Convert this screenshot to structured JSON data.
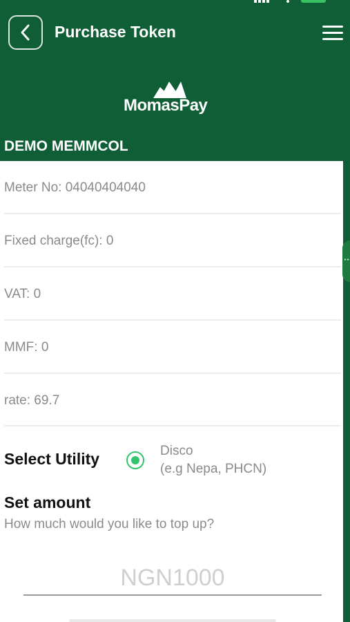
{
  "header": {
    "title": "Purchase Token",
    "back_icon": "chevron-left-icon",
    "menu_icon": "hamburger-menu-icon"
  },
  "brand": {
    "logo_text": "MomasPay",
    "background_color": "#0f5e35",
    "accent_color": "#34c46e"
  },
  "organization": "DEMO MEMMCOL",
  "meter_info": [
    {
      "key": "meter_no",
      "text": "Meter No: 04040404040"
    },
    {
      "key": "fixed_charge",
      "text": "Fixed charge(fc): 0"
    },
    {
      "key": "vat",
      "text": "VAT: 0"
    },
    {
      "key": "mmf",
      "text": "MMF: 0"
    },
    {
      "key": "rate",
      "text": "rate: 69.7"
    }
  ],
  "utility": {
    "label": "Select Utility",
    "selected": true,
    "option_title": "Disco",
    "option_subtitle": "(e.g Nepa, PHCN)"
  },
  "amount": {
    "title": "Set amount",
    "subtitle": "How much would you like to top up?",
    "placeholder": "NGN1000",
    "value": ""
  }
}
